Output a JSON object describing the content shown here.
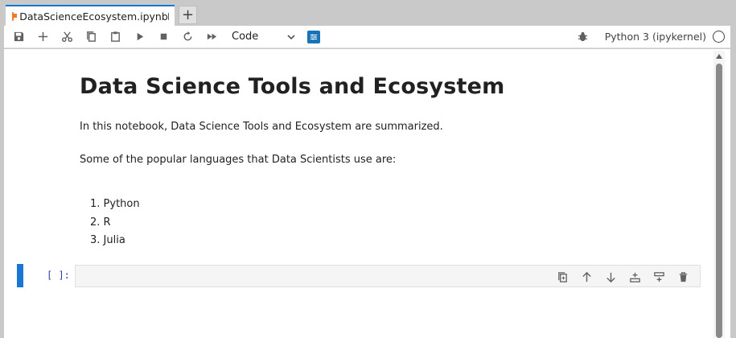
{
  "tab": {
    "title": "DataScienceEcosystem.ipynb",
    "icon": "notebook-icon",
    "accent": "#f37726",
    "unsaved": true
  },
  "toolbar": {
    "buttons": [
      "save-icon",
      "add-cell-icon",
      "cut-icon",
      "copy-icon",
      "paste-icon",
      "run-icon",
      "stop-icon",
      "restart-icon",
      "fast-forward-icon"
    ],
    "cell_type": "Code",
    "kernel_name": "Python 3 (ipykernel)",
    "accent": "#1976d2"
  },
  "markdown": {
    "heading": "Data Science Tools and Ecosystem",
    "intro": "In this notebook, Data Science Tools and Ecosystem are summarized.",
    "languages_intro": "Some of the popular languages that Data Scientists use are:",
    "languages": [
      "Python",
      "R",
      "Julia"
    ],
    "language_numbers": [
      "1.",
      "2.",
      "3."
    ]
  },
  "code_cell": {
    "prompt": "[ ]:",
    "source": "",
    "tools": [
      "duplicate-icon",
      "move-up-icon",
      "move-down-icon",
      "insert-above-icon",
      "insert-below-icon",
      "delete-icon"
    ]
  }
}
